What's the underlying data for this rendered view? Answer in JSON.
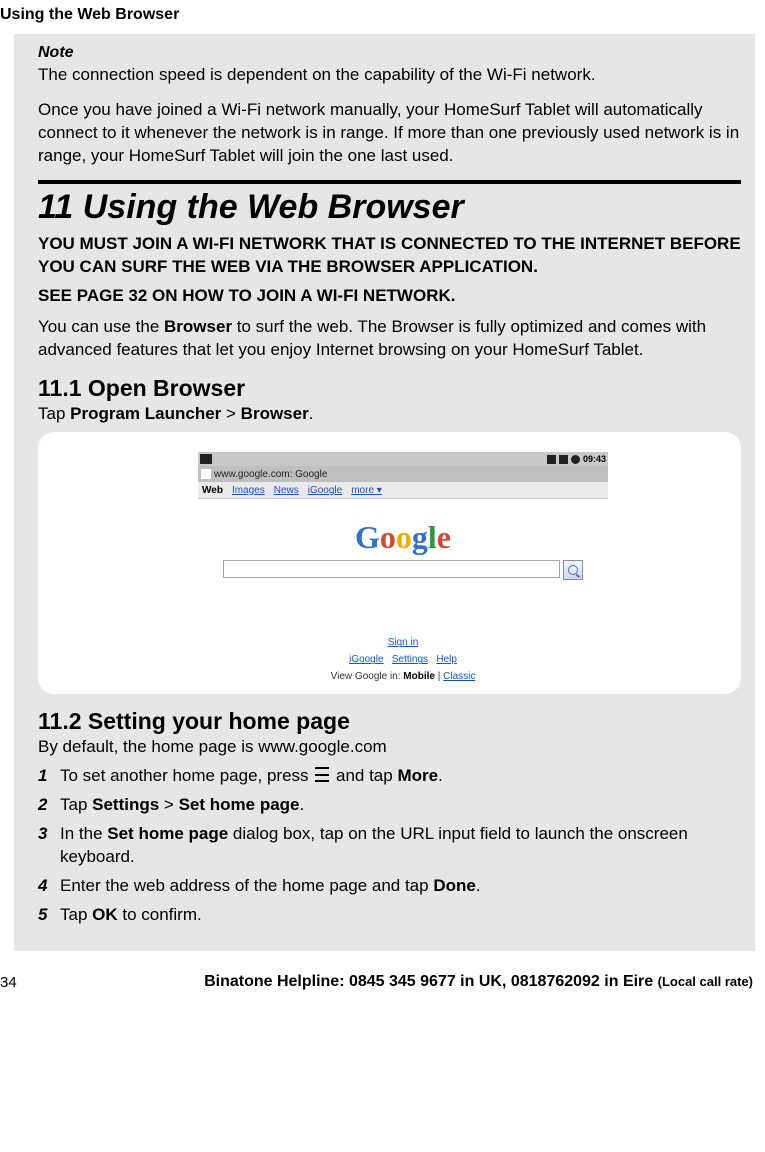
{
  "header": "Using the Web Browser",
  "note": {
    "label": "Note",
    "line1": "The connection speed is dependent on the capability of the Wi-Fi network.",
    "line2": "Once you have joined a Wi-Fi network manually, your HomeSurf Tablet will automatically connect to it whenever the network is in range. If more than one previously used network is in range, your HomeSurf Tablet will join the one last used."
  },
  "chapter": {
    "title": "11 Using the Web Browser",
    "shout1": "YOU MUST JOIN A WI-FI NETWORK THAT IS CONNECTED TO THE INTERNET BEFORE YOU CAN SURF THE WEB VIA THE BROWSER APPLICATION.",
    "shout2": "SEE PAGE 32 ON HOW TO JOIN A WI-FI NETWORK.",
    "intro_pre": "You can use the ",
    "intro_bold": "Browser",
    "intro_post": " to surf the web. The Browser is fully optimized and comes with advanced features that let you enjoy Internet browsing on your HomeSurf Tablet."
  },
  "section_11_1": {
    "heading": "11.1  Open Browser",
    "sub_pre": "Tap ",
    "sub_b1": "Program Launcher",
    "sub_mid": " > ",
    "sub_b2": "Browser",
    "sub_post": "."
  },
  "screenshot": {
    "status_time": "09:43",
    "url": "www.google.com: Google",
    "nav": {
      "web": "Web",
      "images": "Images",
      "news": "News",
      "igoogle": "iGoogle",
      "more": "more ▾"
    },
    "logo": {
      "g1": "G",
      "o1": "o",
      "o2": "o",
      "g2": "g",
      "l": "l",
      "e": "e"
    },
    "signin": "Sign in",
    "links_mid": {
      "igoogle": "iGoogle",
      "settings": "Settings",
      "help": "Help"
    },
    "viewline_pre": "View Google in: ",
    "viewline_mobile": "Mobile",
    "viewline_sep": " | ",
    "viewline_classic": "Classic"
  },
  "section_11_2": {
    "heading": "11.2  Setting your home page",
    "sub": "By default, the home page is www.google.com",
    "steps": {
      "s1_pre": "To set another home page, press ",
      "s1_mid": " and tap ",
      "s1_b": "More",
      "s1_post": ".",
      "s2_pre": "Tap ",
      "s2_b1": "Settings",
      "s2_mid": " > ",
      "s2_b2": "Set home page",
      "s2_post": ".",
      "s3_pre": "In the ",
      "s3_b": "Set home page",
      "s3_post": " dialog box, tap on the URL input field to launch the onscreen keyboard.",
      "s4_pre": "Enter the web address of the home page and tap ",
      "s4_b": "Done",
      "s4_post": ".",
      "s5_pre": "Tap ",
      "s5_b": "OK",
      "s5_post": " to confirm."
    }
  },
  "footer": {
    "page": "34",
    "helpline_main": "Binatone Helpline: 0845 345 9677 in UK, 0818762092 in Eire ",
    "helpline_small": "(Local call rate)"
  }
}
